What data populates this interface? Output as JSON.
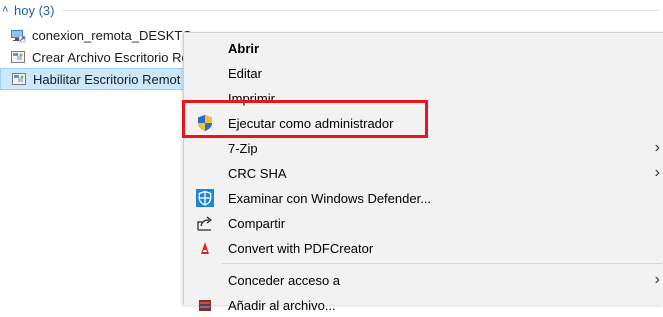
{
  "group": {
    "chevron": "˄",
    "title": "hoy (3)"
  },
  "files": [
    {
      "name": "conexion_remota_DESKTC",
      "icon": "remote-desktop-icon",
      "selected": false
    },
    {
      "name": "Crear Archivo Escritorio Re",
      "icon": "registry-file-icon",
      "selected": false
    },
    {
      "name": "Habilitar Escritorio Remot",
      "icon": "registry-file-icon",
      "selected": true
    }
  ],
  "menu": {
    "open": "Abrir",
    "edit": "Editar",
    "print": "Imprimir",
    "run_as_admin": "Ejecutar como administrador",
    "zip": "7-Zip",
    "crc": "CRC SHA",
    "defender": "Examinar con Windows Defender...",
    "share": "Compartir",
    "pdf": "Convert with PDFCreator",
    "grant_access": "Conceder acceso a",
    "add_archive": "Añadir al archivo..."
  },
  "colors": {
    "highlight": "#e8151c",
    "selection": "#cce8ff",
    "group_title": "#1e5fb4"
  }
}
